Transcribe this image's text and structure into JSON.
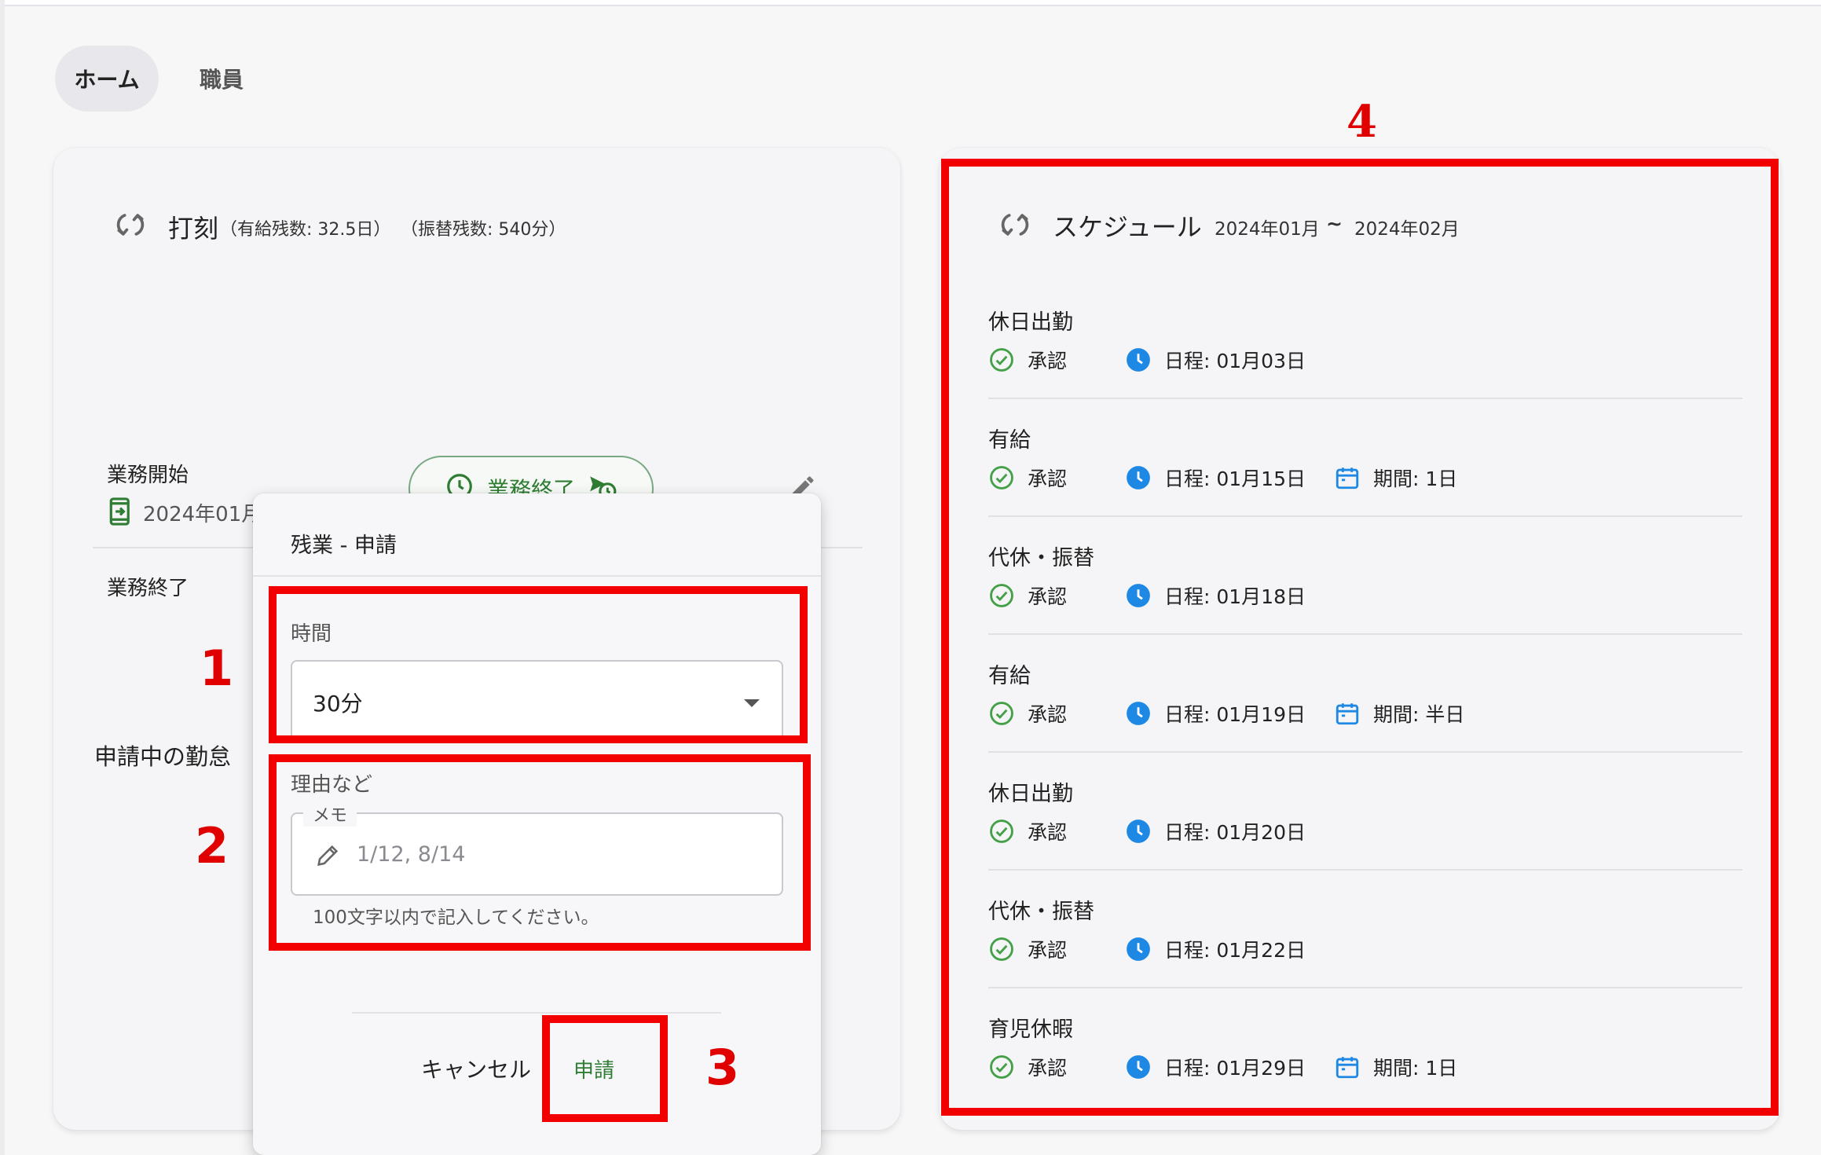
{
  "tabs": [
    {
      "label": "ホーム",
      "active": true
    },
    {
      "label": "職員",
      "active": false
    }
  ],
  "punch_card": {
    "title": "打刻",
    "paid_leave_remaining": "（有給残数: 32.5日）",
    "substitute_remaining": "（振替残数: 540分）",
    "end_work_button": "業務終了",
    "work_start_label": "業務開始",
    "work_start_value": "2024年01月",
    "work_end_label": "業務終了",
    "pending_label": "申請中の勤怠"
  },
  "overtime_dialog": {
    "title": "残業 - 申請",
    "time_label": "時間",
    "time_value": "30分",
    "reason_label": "理由など",
    "memo_legend": "メモ",
    "memo_placeholder": "1/12, 8/14",
    "memo_hint": "100文字以内で記入してください。",
    "cancel_button": "キャンセル",
    "apply_button": "申請"
  },
  "annotations": [
    "1",
    "2",
    "3",
    "4"
  ],
  "schedule": {
    "title": "スケジュール",
    "range_start": "2024年01月",
    "range_sep": "~",
    "range_end": "2024年02月",
    "items": [
      {
        "type": "休日出勤",
        "status": "承認",
        "date": "日程: 01月03日",
        "period": ""
      },
      {
        "type": "有給",
        "status": "承認",
        "date": "日程: 01月15日",
        "period": "期間: 1日"
      },
      {
        "type": "代休・振替",
        "status": "承認",
        "date": "日程: 01月18日",
        "period": ""
      },
      {
        "type": "有給",
        "status": "承認",
        "date": "日程: 01月19日",
        "period": "期間: 半日"
      },
      {
        "type": "休日出勤",
        "status": "承認",
        "date": "日程: 01月20日",
        "period": ""
      },
      {
        "type": "代休・振替",
        "status": "承認",
        "date": "日程: 01月22日",
        "period": ""
      },
      {
        "type": "育児休暇",
        "status": "承認",
        "date": "日程: 01月29日",
        "period": "期間: 1日"
      }
    ]
  },
  "colors": {
    "accent_green": "#2e7d32",
    "approve_green": "#43a047",
    "clock_blue": "#1e88e5",
    "annotation_red": "#f20000"
  },
  "icons": [
    "refresh-icon",
    "clock-icon",
    "clock-send-icon",
    "phone-login-icon",
    "edit-pencil-icon",
    "check-circle-icon",
    "calendar-icon",
    "dropdown-caret-icon"
  ]
}
